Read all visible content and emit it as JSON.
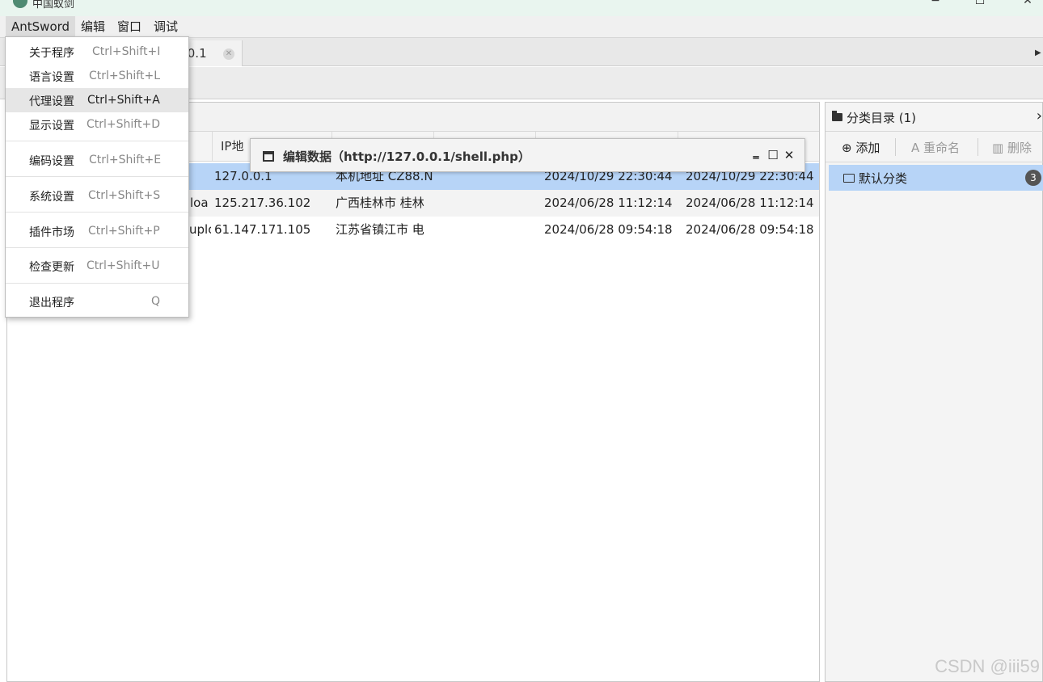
{
  "window": {
    "title": "中国蚁剑",
    "minimize": "−",
    "maximize": "☐",
    "close": "✕"
  },
  "menubar": [
    "AntSword",
    "编辑",
    "窗口",
    "调试"
  ],
  "tab": {
    "label": ".0.1"
  },
  "dropdown": [
    {
      "label": "关于程序",
      "shortcut": "Ctrl+Shift+I"
    },
    {
      "label": "语言设置",
      "shortcut": "Ctrl+Shift+L"
    },
    {
      "label": "代理设置",
      "shortcut": "Ctrl+Shift+A"
    },
    {
      "label": "显示设置",
      "shortcut": "Ctrl+Shift+D"
    },
    {
      "label": "编码设置",
      "shortcut": "Ctrl+Shift+E"
    },
    {
      "label": "系统设置",
      "shortcut": "Ctrl+Shift+S"
    },
    {
      "label": "插件市场",
      "shortcut": "Ctrl+Shift+P"
    },
    {
      "label": "检查更新",
      "shortcut": "Ctrl+Shift+U"
    },
    {
      "label": "退出程序",
      "shortcut": "Q"
    }
  ],
  "table": {
    "headers": [
      "IP地"
    ],
    "rows": [
      {
        "url_partial": "",
        "ip": "127.0.0.1",
        "location": "本机地址 CZ88.N",
        "created": "2024/10/29 22:30:44",
        "updated": "2024/10/29 22:30:44"
      },
      {
        "url_partial": "loa",
        "ip": "125.217.36.102",
        "location": "广西桂林市 桂林",
        "created": "2024/06/28 11:12:14",
        "updated": "2024/06/28 11:12:14"
      },
      {
        "url_partial": "uplo",
        "ip": "61.147.171.105",
        "location": "江苏省镇江市 电",
        "created": "2024/06/28 09:54:18",
        "updated": "2024/06/28 09:54:18"
      }
    ]
  },
  "dialog": {
    "title": "编辑数据（http://127.0.0.1/shell.php）",
    "minimize": "‗",
    "maximize": "☐",
    "close": "✕"
  },
  "category": {
    "title": "分类目录 (1)",
    "add": "添加",
    "rename": "重命名",
    "delete": "删除",
    "items": [
      {
        "label": "默认分类",
        "count": "3"
      }
    ]
  },
  "watermark": "CSDN @iii59"
}
